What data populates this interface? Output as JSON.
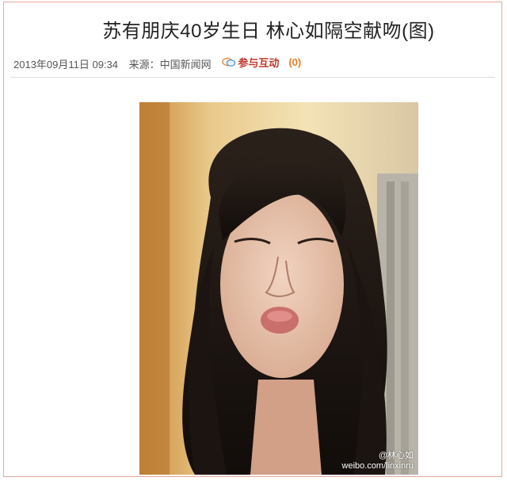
{
  "article": {
    "title": "苏有朋庆40岁生日 林心如隔空献吻(图)",
    "date": "2013年09月11日 09:34",
    "source_label": "来源：",
    "source_name": "中国新闻网",
    "comment_label": "参与互动",
    "comment_count": "(0)"
  },
  "photo": {
    "watermark_name": "@林心如",
    "watermark_url": "weibo.com/linxinru"
  },
  "icons": [
    "comment-bubble-icon"
  ],
  "colors": {
    "frame_border": "#e4a99a",
    "comment_red": "#c0392b",
    "comment_count_orange": "#e67e22"
  }
}
